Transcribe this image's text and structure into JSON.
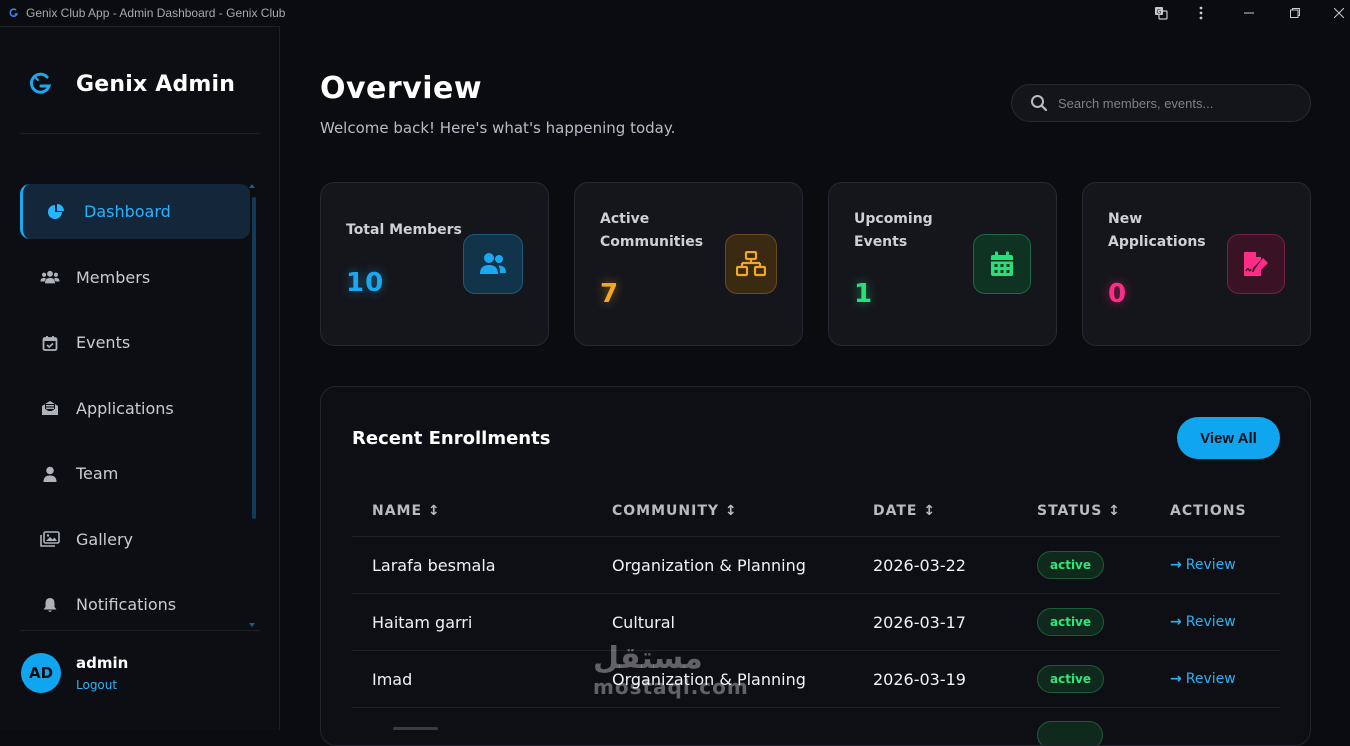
{
  "window": {
    "title": "Genix Club App - Admin Dashboard - Genix Club"
  },
  "sidebar": {
    "brand": "Genix Admin",
    "items": [
      {
        "label": "Dashboard",
        "icon": "pie-chart-icon",
        "active": true
      },
      {
        "label": "Members",
        "icon": "users-icon"
      },
      {
        "label": "Events",
        "icon": "calendar-check-icon"
      },
      {
        "label": "Applications",
        "icon": "envelope-open-icon"
      },
      {
        "label": "Team",
        "icon": "user-icon"
      },
      {
        "label": "Gallery",
        "icon": "images-icon"
      },
      {
        "label": "Notifications",
        "icon": "bell-icon"
      }
    ],
    "user": {
      "initials": "AD",
      "name": "admin",
      "logout": "Logout"
    }
  },
  "header": {
    "title": "Overview",
    "subtitle": "Welcome back! Here's what's happening today.",
    "search_placeholder": "Search members, events..."
  },
  "stats": [
    {
      "label": "Total Members",
      "value": "10",
      "color": "#1aa8f0",
      "icon": "users-icon"
    },
    {
      "label": "Active Communities",
      "value": "7",
      "color": "#f5a623",
      "icon": "sitemap-icon"
    },
    {
      "label": "Upcoming Events",
      "value": "1",
      "color": "#27e07a",
      "icon": "calendar-icon"
    },
    {
      "label": "New Applications",
      "value": "0",
      "color": "#ff2d86",
      "icon": "file-signature-icon"
    }
  ],
  "enrollments": {
    "title": "Recent Enrollments",
    "view_all": "View All",
    "columns": [
      "NAME ↕",
      "COMMUNITY ↕",
      "DATE ↕",
      "STATUS ↕",
      "ACTIONS"
    ],
    "rows": [
      {
        "name": "Larafa besmala",
        "community": "Organization & Planning",
        "date": "2026-03-22",
        "status": "active",
        "action": "Review"
      },
      {
        "name": "Haitam garri",
        "community": "Cultural",
        "date": "2026-03-17",
        "status": "active",
        "action": "Review"
      },
      {
        "name": "Imad",
        "community": "Organization & Planning",
        "date": "2026-03-19",
        "status": "active",
        "action": "Review"
      }
    ]
  },
  "watermark": {
    "text": "مستقل",
    "subtext": "mostaql.com"
  },
  "colors": {
    "accent": "#10a6ef",
    "background": "#0b0c10",
    "success": "#2ee77a"
  }
}
